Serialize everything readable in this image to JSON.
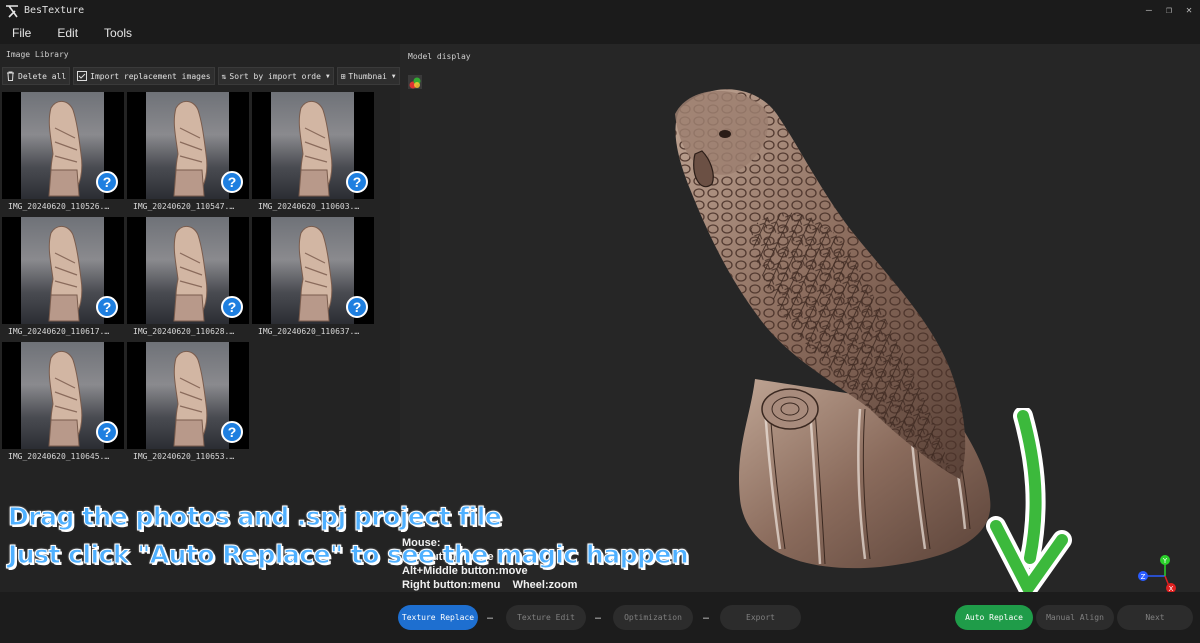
{
  "titlebar": {
    "title": "BesTexture",
    "minimize": "—",
    "restore": "❐",
    "close": "✕"
  },
  "menu": {
    "items": [
      "File",
      "Edit",
      "Tools"
    ]
  },
  "image_library": {
    "title": "Image Library",
    "toolbar": {
      "delete_all": "Delete all",
      "import": "Import replacement images",
      "sort": "Sort by import orde",
      "view": "Thumbnai"
    },
    "thumbnails": [
      {
        "label": "IMG_20240620_110526.…",
        "badge": "?"
      },
      {
        "label": "IMG_20240620_110547.…",
        "badge": "?"
      },
      {
        "label": "IMG_20240620_110603.…",
        "badge": "?"
      },
      {
        "label": "IMG_20240620_110617.…",
        "badge": "?"
      },
      {
        "label": "IMG_20240620_110628.…",
        "badge": "?"
      },
      {
        "label": "IMG_20240620_110637.…",
        "badge": "?"
      },
      {
        "label": "IMG_20240620_110645.…",
        "badge": "?"
      },
      {
        "label": "IMG_20240620_110653.…",
        "badge": "?"
      }
    ]
  },
  "model_display": {
    "title": "Model display",
    "mouse_help": {
      "line1": "Mouse:",
      "line2": "Left button:rotate",
      "line3": "Alt+Middle button:move",
      "line4": "Right button:menu    Wheel:zoom"
    },
    "axes": {
      "x": "X",
      "y": "Y",
      "z": "Z"
    }
  },
  "overlay": {
    "line1": "Drag the photos and .spj project file",
    "line2": "Just click \"Auto Replace\" to see the magic happen"
  },
  "bottom_bar": {
    "steps": [
      "Texture Replace",
      "Texture Edit",
      "Optimization",
      "Export"
    ],
    "separator": "…",
    "auto_replace": "Auto Replace",
    "manual_align": "Manual Align",
    "next": "Next"
  },
  "colors": {
    "accent_blue": "#1e6fd0",
    "accent_green": "#1f9c49",
    "badge_blue": "#1e7fe0",
    "overlay_text": "#4fb0ff"
  }
}
